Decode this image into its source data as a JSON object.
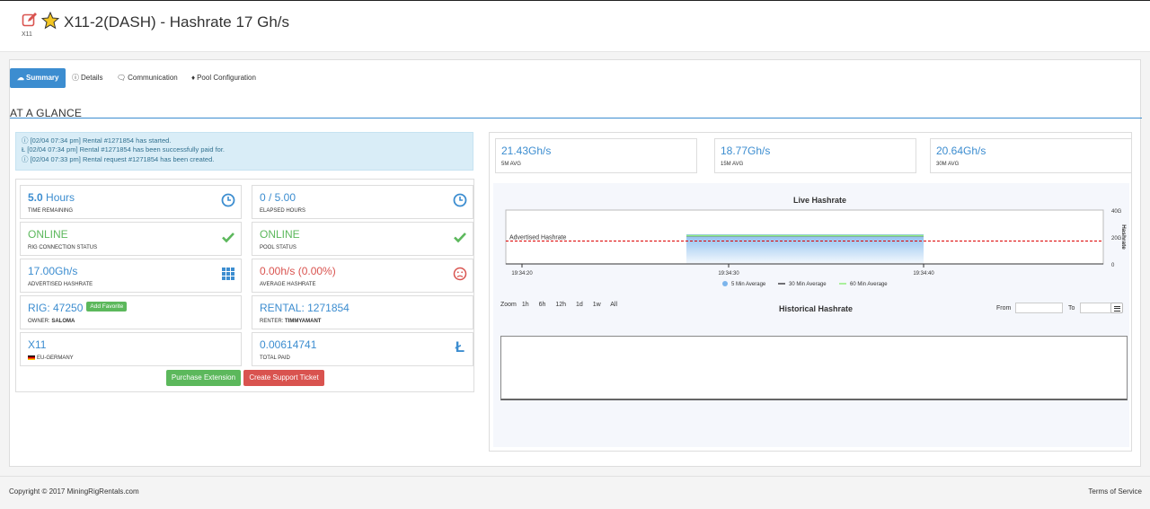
{
  "header": {
    "title": "X11-2(DASH) - Hashrate 17 Gh/s",
    "algo": "X11"
  },
  "tabs": [
    {
      "label": "Summary",
      "active": true
    },
    {
      "label": "Details"
    },
    {
      "label": "Communication"
    },
    {
      "label": "Pool Configuration"
    }
  ],
  "section_title": "AT A GLANCE",
  "alerts": [
    "[02/04 07:34 pm] Rental #1271854 has started.",
    "[02/04 07:34 pm] Rental #1271854 has been successfully paid for.",
    "[02/04 07:33 pm] Rental request #1271854 has been created."
  ],
  "stats": {
    "time_remaining": {
      "value_bold": "5.0",
      "value_rest": " Hours",
      "label": "TIME REMAINING"
    },
    "elapsed_hours": {
      "value": "0 / 5.00",
      "label": "ELAPSED HOURS"
    },
    "rig_status": {
      "value": "ONLINE",
      "label": "RIG CONNECTION STATUS"
    },
    "pool_status": {
      "value": "ONLINE",
      "label": "POOL STATUS"
    },
    "advertised": {
      "value": "17.00Gh/s",
      "label": "ADVERTISED HASHRATE"
    },
    "average": {
      "value": "0.00h/s (0.00%)",
      "label": "AVERAGE HASHRATE"
    },
    "rig": {
      "value": "RIG: 47250",
      "fav_label": "Add Favorite",
      "owner_label": "OWNER: ",
      "owner": "SALOMA"
    },
    "rental": {
      "value": "RENTAL: 1271854",
      "renter_label": "RENTER: ",
      "renter": "TIMMYAMANT"
    },
    "algo": {
      "value": "X11",
      "region": "EU-GERMANY"
    },
    "paid": {
      "value": "0.00614741",
      "label": "TOTAL PAID"
    }
  },
  "buttons": {
    "purchase": "Purchase Extension",
    "support": "Create Support Ticket"
  },
  "averages": [
    {
      "value": "21.43Gh/s",
      "label": "5M AVG"
    },
    {
      "value": "18.77Gh/s",
      "label": "15M AVG"
    },
    {
      "value": "20.64Gh/s",
      "label": "30M AVG"
    }
  ],
  "live_chart": {
    "title": "Live Hashrate",
    "advertised_label": "Advertised Hashrate",
    "y_ticks": [
      "40G",
      "20G",
      "0"
    ],
    "y_axis_label": "Hashrate",
    "x_ticks": [
      "19:34:20",
      "19:34:30",
      "19:34:40"
    ],
    "legend": [
      {
        "name": "5 Min Average",
        "color": "#7cb5ec"
      },
      {
        "name": "30 Min Average",
        "color": "#434348"
      },
      {
        "name": "60 Min Average",
        "color": "#90ed7d"
      }
    ]
  },
  "chart_data": {
    "type": "area",
    "title": "Live Hashrate",
    "ylabel": "Hashrate",
    "ylim": [
      0,
      40
    ],
    "x_ticks": [
      "19:34:20",
      "19:34:30",
      "19:34:40"
    ],
    "advertised_hashrate": 17,
    "series": [
      {
        "name": "5 Min Average",
        "x": [
          "19:34:30",
          "19:34:40"
        ],
        "values": [
          21.43,
          21.43
        ]
      },
      {
        "name": "30 Min Average",
        "x": [
          "19:34:30",
          "19:34:40"
        ],
        "values": [
          20.64,
          20.64
        ]
      },
      {
        "name": "60 Min Average",
        "x": [
          "19:34:30",
          "19:34:40"
        ],
        "values": [
          21.0,
          21.0
        ]
      }
    ]
  },
  "historical": {
    "title": "Historical Hashrate",
    "zoom_label": "Zoom",
    "zoom_options": [
      "1h",
      "6h",
      "12h",
      "1d",
      "1w",
      "All"
    ],
    "from_label": "From",
    "to_label": "To"
  },
  "footer": {
    "copyright": "Copyright © 2017 MiningRigRentals.com",
    "terms": "Terms of Service"
  },
  "colors": {
    "accent": "#3c8dd0",
    "success": "#5cb85c",
    "danger": "#d9534f",
    "info_bg": "#d9edf7"
  }
}
